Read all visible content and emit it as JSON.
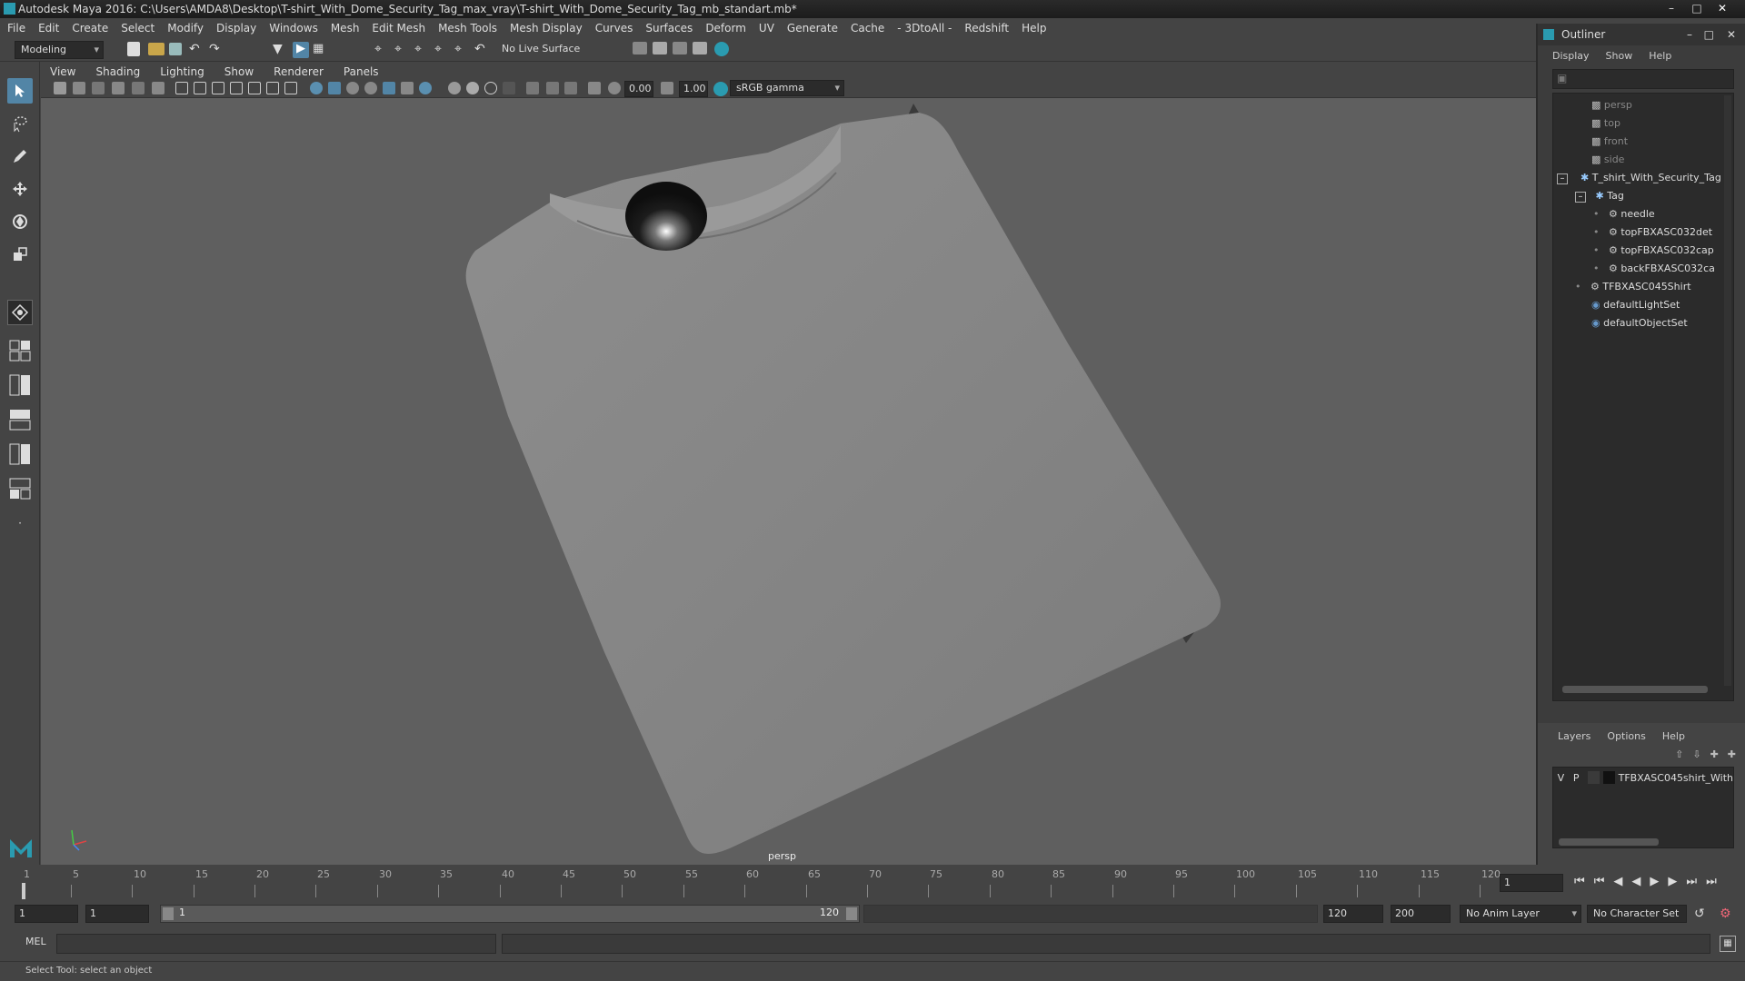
{
  "window": {
    "title": "Autodesk Maya 2016: C:\\Users\\AMDA8\\Desktop\\T-shirt_With_Dome_Security_Tag_max_vray\\T-shirt_With_Dome_Security_Tag_mb_standart.mb*"
  },
  "menubar": [
    "File",
    "Edit",
    "Create",
    "Select",
    "Modify",
    "Display",
    "Windows",
    "Mesh",
    "Edit Mesh",
    "Mesh Tools",
    "Mesh Display",
    "Curves",
    "Surfaces",
    "Deform",
    "UV",
    "Generate",
    "Cache",
    "- 3DtoAll -",
    "Redshift",
    "Help"
  ],
  "shelf": {
    "mode": "Modeling",
    "live_surface": "No Live Surface"
  },
  "viewport": {
    "menu": [
      "View",
      "Shading",
      "Lighting",
      "Show",
      "Renderer",
      "Panels"
    ],
    "exposure": "0.00",
    "gamma": "1.00",
    "color_space": "sRGB gamma",
    "camera_label": "persp"
  },
  "outliner": {
    "title": "Outliner",
    "menu": [
      "Display",
      "Show",
      "Help"
    ],
    "items": [
      {
        "label": "persp",
        "kind": "camera"
      },
      {
        "label": "top",
        "kind": "camera"
      },
      {
        "label": "front",
        "kind": "camera"
      },
      {
        "label": "side",
        "kind": "camera"
      },
      {
        "label": "T_shirt_With_Security_Tag",
        "kind": "group"
      },
      {
        "label": "Tag",
        "kind": "group"
      },
      {
        "label": "needle",
        "kind": "mesh"
      },
      {
        "label": "topFBXASC032det",
        "kind": "mesh"
      },
      {
        "label": "topFBXASC032cap",
        "kind": "mesh"
      },
      {
        "label": "backFBXASC032ca",
        "kind": "mesh"
      },
      {
        "label": "TFBXASC045Shirt",
        "kind": "mesh"
      },
      {
        "label": "defaultLightSet",
        "kind": "set"
      },
      {
        "label": "defaultObjectSet",
        "kind": "set"
      }
    ]
  },
  "layers": {
    "menu": [
      "Layers",
      "Options",
      "Help"
    ],
    "row": {
      "v": "V",
      "p": "P",
      "name": "TFBXASC045shirt_With"
    }
  },
  "timeline": {
    "ticks": [
      "1",
      "5",
      "10",
      "15",
      "20",
      "25",
      "30",
      "35",
      "40",
      "45",
      "50",
      "55",
      "60",
      "65",
      "70",
      "75",
      "80",
      "85",
      "90",
      "95",
      "100",
      "105",
      "110",
      "115",
      "120"
    ],
    "current_frame": "1"
  },
  "range": {
    "start": "1",
    "playback_start": "1",
    "slider_start": "1",
    "slider_end": "120",
    "playback_end": "120",
    "end": "200",
    "anim_layer": "No Anim Layer",
    "character_set": "No Character Set"
  },
  "command": {
    "lang": "MEL"
  },
  "status": {
    "text": "Select Tool: select an object"
  },
  "colors": {
    "accent": "#2a9bb0",
    "selection": "#5285a6",
    "background": "#444444",
    "viewport": "#5f5f5f"
  }
}
